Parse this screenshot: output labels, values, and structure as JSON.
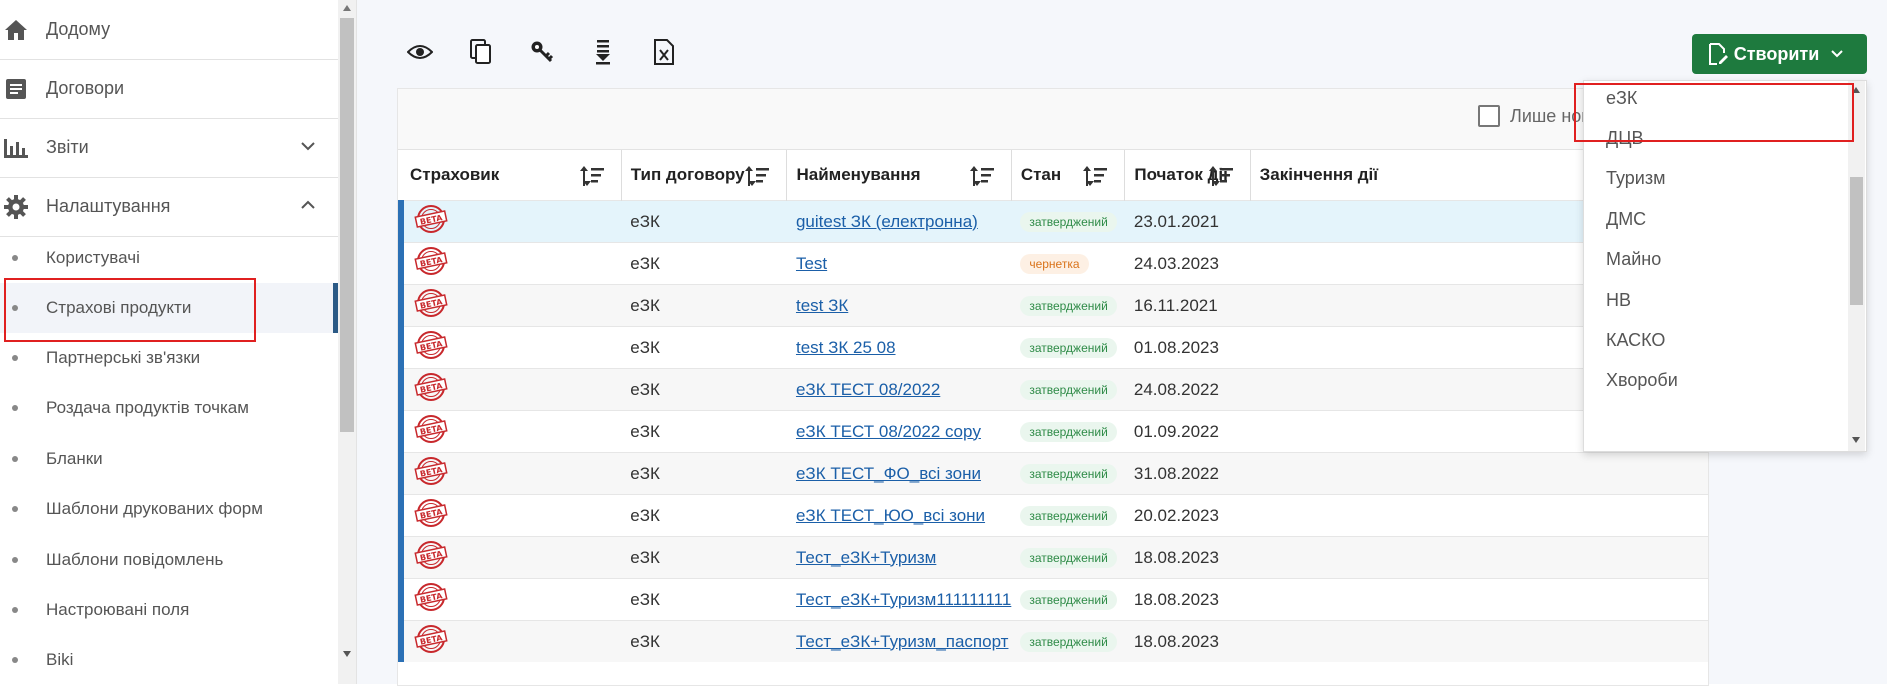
{
  "sidebar": {
    "nav": [
      {
        "label": "Додому",
        "icon": "home-icon"
      },
      {
        "label": "Договори",
        "icon": "document-icon"
      },
      {
        "label": "Звіти",
        "icon": "bar-chart-icon",
        "chevron": "down"
      },
      {
        "label": "Налаштування",
        "icon": "gear-icon",
        "chevron": "up"
      }
    ],
    "subitems": [
      {
        "label": "Користувачі"
      },
      {
        "label": "Страхові продукти",
        "active": true
      },
      {
        "label": "Партнерські зв'язки"
      },
      {
        "label": "Роздача продуктів точкам"
      },
      {
        "label": "Бланки"
      },
      {
        "label": "Шаблони друкованих форм"
      },
      {
        "label": "Шаблони повідомлень"
      },
      {
        "label": "Настроювані поля"
      },
      {
        "label": "Віki"
      }
    ]
  },
  "toolbar": {
    "icons": [
      "eye-icon",
      "copy-icon",
      "key-icon",
      "download-icon",
      "excel-export-icon"
    ],
    "create_label": "Створити"
  },
  "filter": {
    "only_new_label": "Лише нові",
    "only_new_checked": false
  },
  "table": {
    "headers": [
      "Страховик",
      "Тип договору",
      "Найменування",
      "Стан",
      "Початок дії",
      "Закінчення дії"
    ],
    "rows": [
      {
        "insurer_icon": "beta-stamp-icon",
        "type": "еЗК",
        "name": "guitest ЗК (електронна)",
        "status": "затверджений",
        "status_kind": "ok",
        "start": "23.01.2021",
        "end": ""
      },
      {
        "insurer_icon": "beta-stamp-icon",
        "type": "еЗК",
        "name": "Test",
        "status": "чернетка",
        "status_kind": "draft",
        "start": "24.03.2023",
        "end": ""
      },
      {
        "insurer_icon": "beta-stamp-icon",
        "type": "еЗК",
        "name": "test ЗК",
        "status": "затверджений",
        "status_kind": "ok",
        "start": "16.11.2021",
        "end": ""
      },
      {
        "insurer_icon": "beta-stamp-icon",
        "type": "еЗК",
        "name": "test ЗК 25 08",
        "status": "затверджений",
        "status_kind": "ok",
        "start": "01.08.2023",
        "end": ""
      },
      {
        "insurer_icon": "beta-stamp-icon",
        "type": "еЗК",
        "name": "еЗК ТЕСТ 08/2022",
        "status": "затверджений",
        "status_kind": "ok",
        "start": "24.08.2022",
        "end": ""
      },
      {
        "insurer_icon": "beta-stamp-icon",
        "type": "еЗК",
        "name": "еЗК ТЕСТ 08/2022 copy",
        "status": "затверджений",
        "status_kind": "ok",
        "start": "01.09.2022",
        "end": ""
      },
      {
        "insurer_icon": "beta-stamp-icon",
        "type": "еЗК",
        "name": "еЗК ТЕСТ_ФО_всі зони",
        "status": "затверджений",
        "status_kind": "ok",
        "start": "31.08.2022",
        "end": ""
      },
      {
        "insurer_icon": "beta-stamp-icon",
        "type": "еЗК",
        "name": "еЗК ТЕСТ_ЮО_всі зони",
        "status": "затверджений",
        "status_kind": "ok",
        "start": "20.02.2023",
        "end": ""
      },
      {
        "insurer_icon": "beta-stamp-icon",
        "type": "еЗК",
        "name": "Тест_еЗК+Туризм",
        "status": "затверджений",
        "status_kind": "ok",
        "start": "18.08.2023",
        "end": ""
      },
      {
        "insurer_icon": "beta-stamp-icon",
        "type": "еЗК",
        "name": "Тест_еЗК+Туризм111111111",
        "status": "затверджений",
        "status_kind": "ok",
        "start": "18.08.2023",
        "end": ""
      },
      {
        "insurer_icon": "beta-stamp-icon",
        "type": "еЗК",
        "name": "Тест_еЗК+Туризм_паспорт",
        "status": "затверджений",
        "status_kind": "ok",
        "start": "18.08.2023",
        "end": ""
      }
    ]
  },
  "dropdown": {
    "items": [
      "еЗК",
      "ДЦВ",
      "Туризм",
      "ДМС",
      "Майно",
      "НВ",
      "КАСКО",
      "Хвороби"
    ]
  },
  "colors": {
    "create_button": "#1e7a3e",
    "active_indicator": "#2b5a86",
    "row_accent": "#2b70b5",
    "highlight_box": "#e02020",
    "status_ok": "#2e8b47",
    "status_draft": "#d9731a"
  }
}
